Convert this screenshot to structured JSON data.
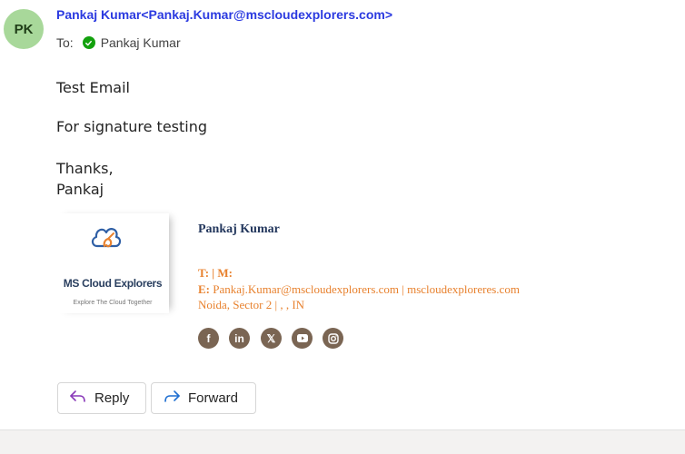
{
  "header": {
    "avatar_initials": "PK",
    "sender": "Pankaj Kumar<Pankaj.Kumar@mscloudexplorers.com>",
    "to_label": "To:",
    "recipient": "Pankaj Kumar"
  },
  "body": {
    "line1": "Test Email",
    "line2": "For signature testing",
    "line3": "Thanks,",
    "line4": "Pankaj"
  },
  "signature": {
    "logo_name": "MS Cloud Explorers",
    "logo_tagline": "Explore The Cloud Together",
    "name": "Pankaj Kumar",
    "phone_label": "T: | M:",
    "email_prefix": "E:",
    "email_line": "Pankaj.Kumar@mscloudexplorers.com | mscloudexploreres.com",
    "address": "Noida, Sector 2 | , , IN",
    "social_icons": [
      "facebook-icon",
      "linkedin-icon",
      "x-icon",
      "youtube-icon",
      "instagram-icon"
    ]
  },
  "actions": {
    "reply_label": "Reply",
    "forward_label": "Forward"
  },
  "colors": {
    "sender": "#2b3ae0",
    "signature_accent": "#e8822f",
    "signature_name": "#23375d",
    "social_bg": "#7a6553",
    "avatar_bg": "#a8d89a"
  }
}
